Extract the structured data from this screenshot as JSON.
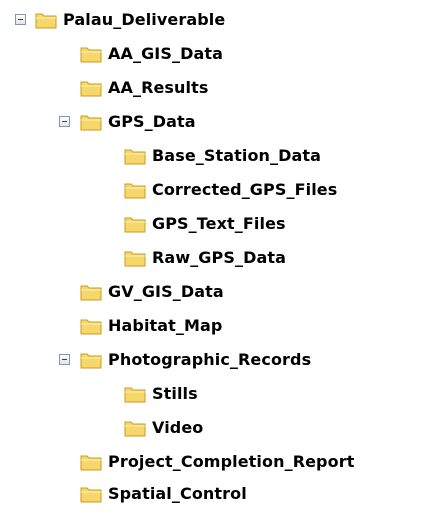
{
  "tree": {
    "items": [
      {
        "label": "Palau_Deliverable",
        "expanded": true,
        "has_children": true,
        "icon": "folder-icon"
      },
      {
        "label": "AA_GIS_Data",
        "icon": "folder-icon"
      },
      {
        "label": "AA_Results",
        "icon": "folder-icon"
      },
      {
        "label": "GPS_Data",
        "expanded": true,
        "has_children": true,
        "icon": "folder-icon"
      },
      {
        "label": "Base_Station_Data",
        "icon": "folder-icon"
      },
      {
        "label": "Corrected_GPS_Files",
        "icon": "folder-icon"
      },
      {
        "label": "GPS_Text_Files",
        "icon": "folder-icon"
      },
      {
        "label": "Raw_GPS_Data",
        "icon": "folder-icon"
      },
      {
        "label": "GV_GIS_Data",
        "icon": "folder-icon"
      },
      {
        "label": "Habitat_Map",
        "icon": "folder-icon"
      },
      {
        "label": "Photographic_Records",
        "expanded": true,
        "has_children": true,
        "icon": "folder-icon"
      },
      {
        "label": "Stills",
        "icon": "folder-icon"
      },
      {
        "label": "Video",
        "icon": "folder-icon"
      },
      {
        "label": "Project_Completion_Report",
        "icon": "folder-icon"
      },
      {
        "label": "Spatial_Control",
        "icon": "folder-icon"
      }
    ],
    "toggle_symbol": "minus-box",
    "colors": {
      "folder_fill": "#f6d76b",
      "folder_outline": "#c89b1e",
      "toggle_border": "#7f96b4",
      "text": "#000000",
      "background": "#ffffff"
    }
  }
}
